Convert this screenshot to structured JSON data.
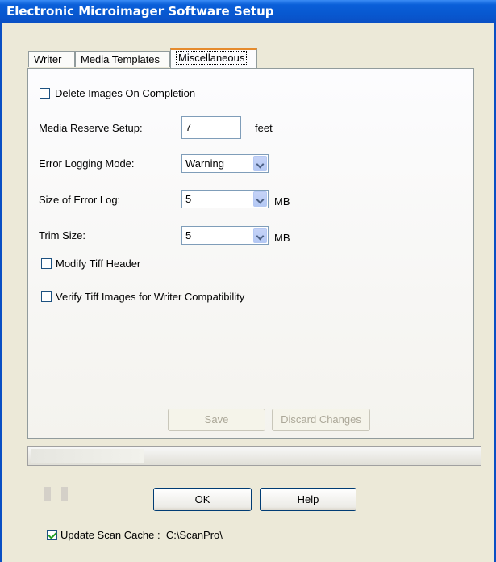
{
  "window": {
    "title": "Electronic Microimager Software Setup"
  },
  "tabs": [
    {
      "label": "Writer",
      "active": false
    },
    {
      "label": "Media Templates",
      "active": false
    },
    {
      "label": "Miscellaneous",
      "active": true
    }
  ],
  "misc": {
    "delete_images": {
      "label": "Delete Images On Completion",
      "checked": false
    },
    "media_reserve": {
      "label": "Media Reserve Setup:",
      "value": "7",
      "unit": "feet"
    },
    "error_logging": {
      "label": "Error Logging Mode:",
      "value": "Warning"
    },
    "error_log_size": {
      "label": "Size of Error Log:",
      "value": "5",
      "unit": "MB"
    },
    "trim_size": {
      "label": "Trim Size:",
      "value": "5",
      "unit": "MB"
    },
    "modify_tiff": {
      "label": "Modify Tiff Header",
      "checked": false
    },
    "verify_tiff": {
      "label": "Verify Tiff Images for Writer Compatibility",
      "checked": false
    },
    "save_label": "Save",
    "discard_label": "Discard Changes"
  },
  "footer": {
    "ok_label": "OK",
    "help_label": "Help",
    "update_cache": {
      "label": "Update Scan Cache :",
      "checked": true,
      "path": "C:\\ScanPro\\"
    }
  },
  "colors": {
    "titlebar": "#0a5fd9",
    "dialog_bg": "#ece9d8",
    "active_tab_accent": "#e68b2c"
  }
}
